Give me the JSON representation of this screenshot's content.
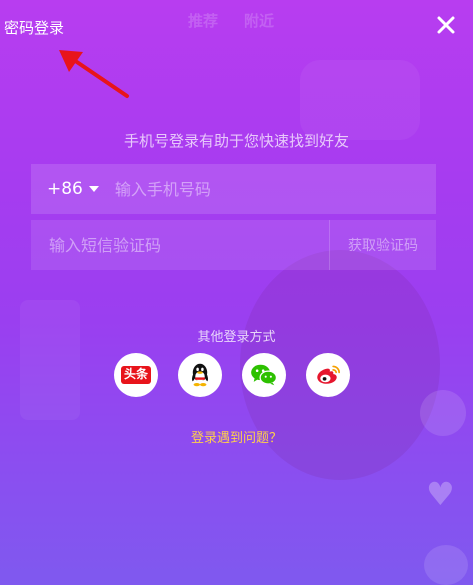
{
  "header": {
    "password_login_label": "密码登录",
    "faint_tabs": [
      "推荐",
      "附近"
    ]
  },
  "form": {
    "subtitle": "手机号登录有助于您快速找到好友",
    "country_code": "+86",
    "phone_placeholder": "输入手机号码",
    "code_placeholder": "输入短信验证码",
    "get_code_label": "获取验证码"
  },
  "social": {
    "title": "其他登录方式",
    "providers": [
      {
        "name": "头条",
        "icon": "toutiao-icon",
        "color": "#e8141b"
      },
      {
        "name": "QQ",
        "icon": "qq-penguin-icon",
        "color": "#000000"
      },
      {
        "name": "WeChat",
        "icon": "wechat-icon",
        "color": "#2dc100"
      },
      {
        "name": "Weibo",
        "icon": "weibo-icon",
        "color": "#e6162d"
      }
    ]
  },
  "help": {
    "trouble_label": "登录遇到问题？"
  },
  "colors": {
    "background_top": "#b83df0",
    "background_bottom": "#7f59ef",
    "link_yellow": "#ffd04a",
    "annotation_arrow": "#e8141b"
  }
}
